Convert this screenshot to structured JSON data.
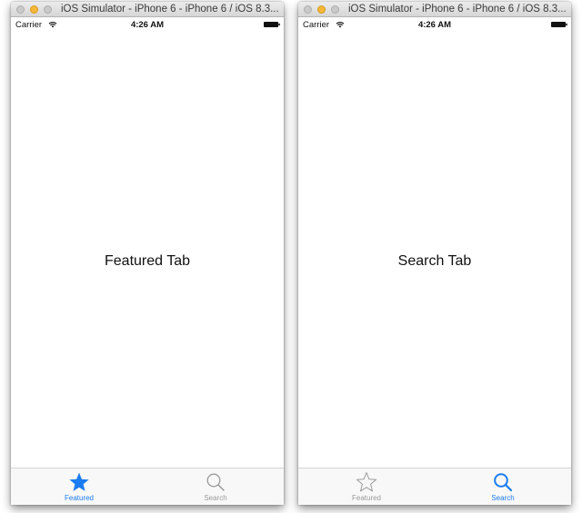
{
  "colors": {
    "accent": "#1a7cf0",
    "inactive": "#9a9a9a"
  },
  "windows": [
    {
      "title": "iOS Simulator - iPhone 6 - iPhone 6 / iOS 8.3...",
      "status": {
        "carrier": "Carrier",
        "time": "4:26 AM"
      },
      "content_label": "Featured Tab",
      "tabs": [
        {
          "label": "Featured",
          "icon": "star-filled-icon",
          "active": true
        },
        {
          "label": "Search",
          "icon": "search-icon",
          "active": false
        }
      ]
    },
    {
      "title": "iOS Simulator - iPhone 6 - iPhone 6 / iOS 8.3...",
      "status": {
        "carrier": "Carrier",
        "time": "4:26 AM"
      },
      "content_label": "Search Tab",
      "tabs": [
        {
          "label": "Featured",
          "icon": "star-outline-icon",
          "active": false
        },
        {
          "label": "Search",
          "icon": "search-icon",
          "active": true
        }
      ]
    }
  ]
}
